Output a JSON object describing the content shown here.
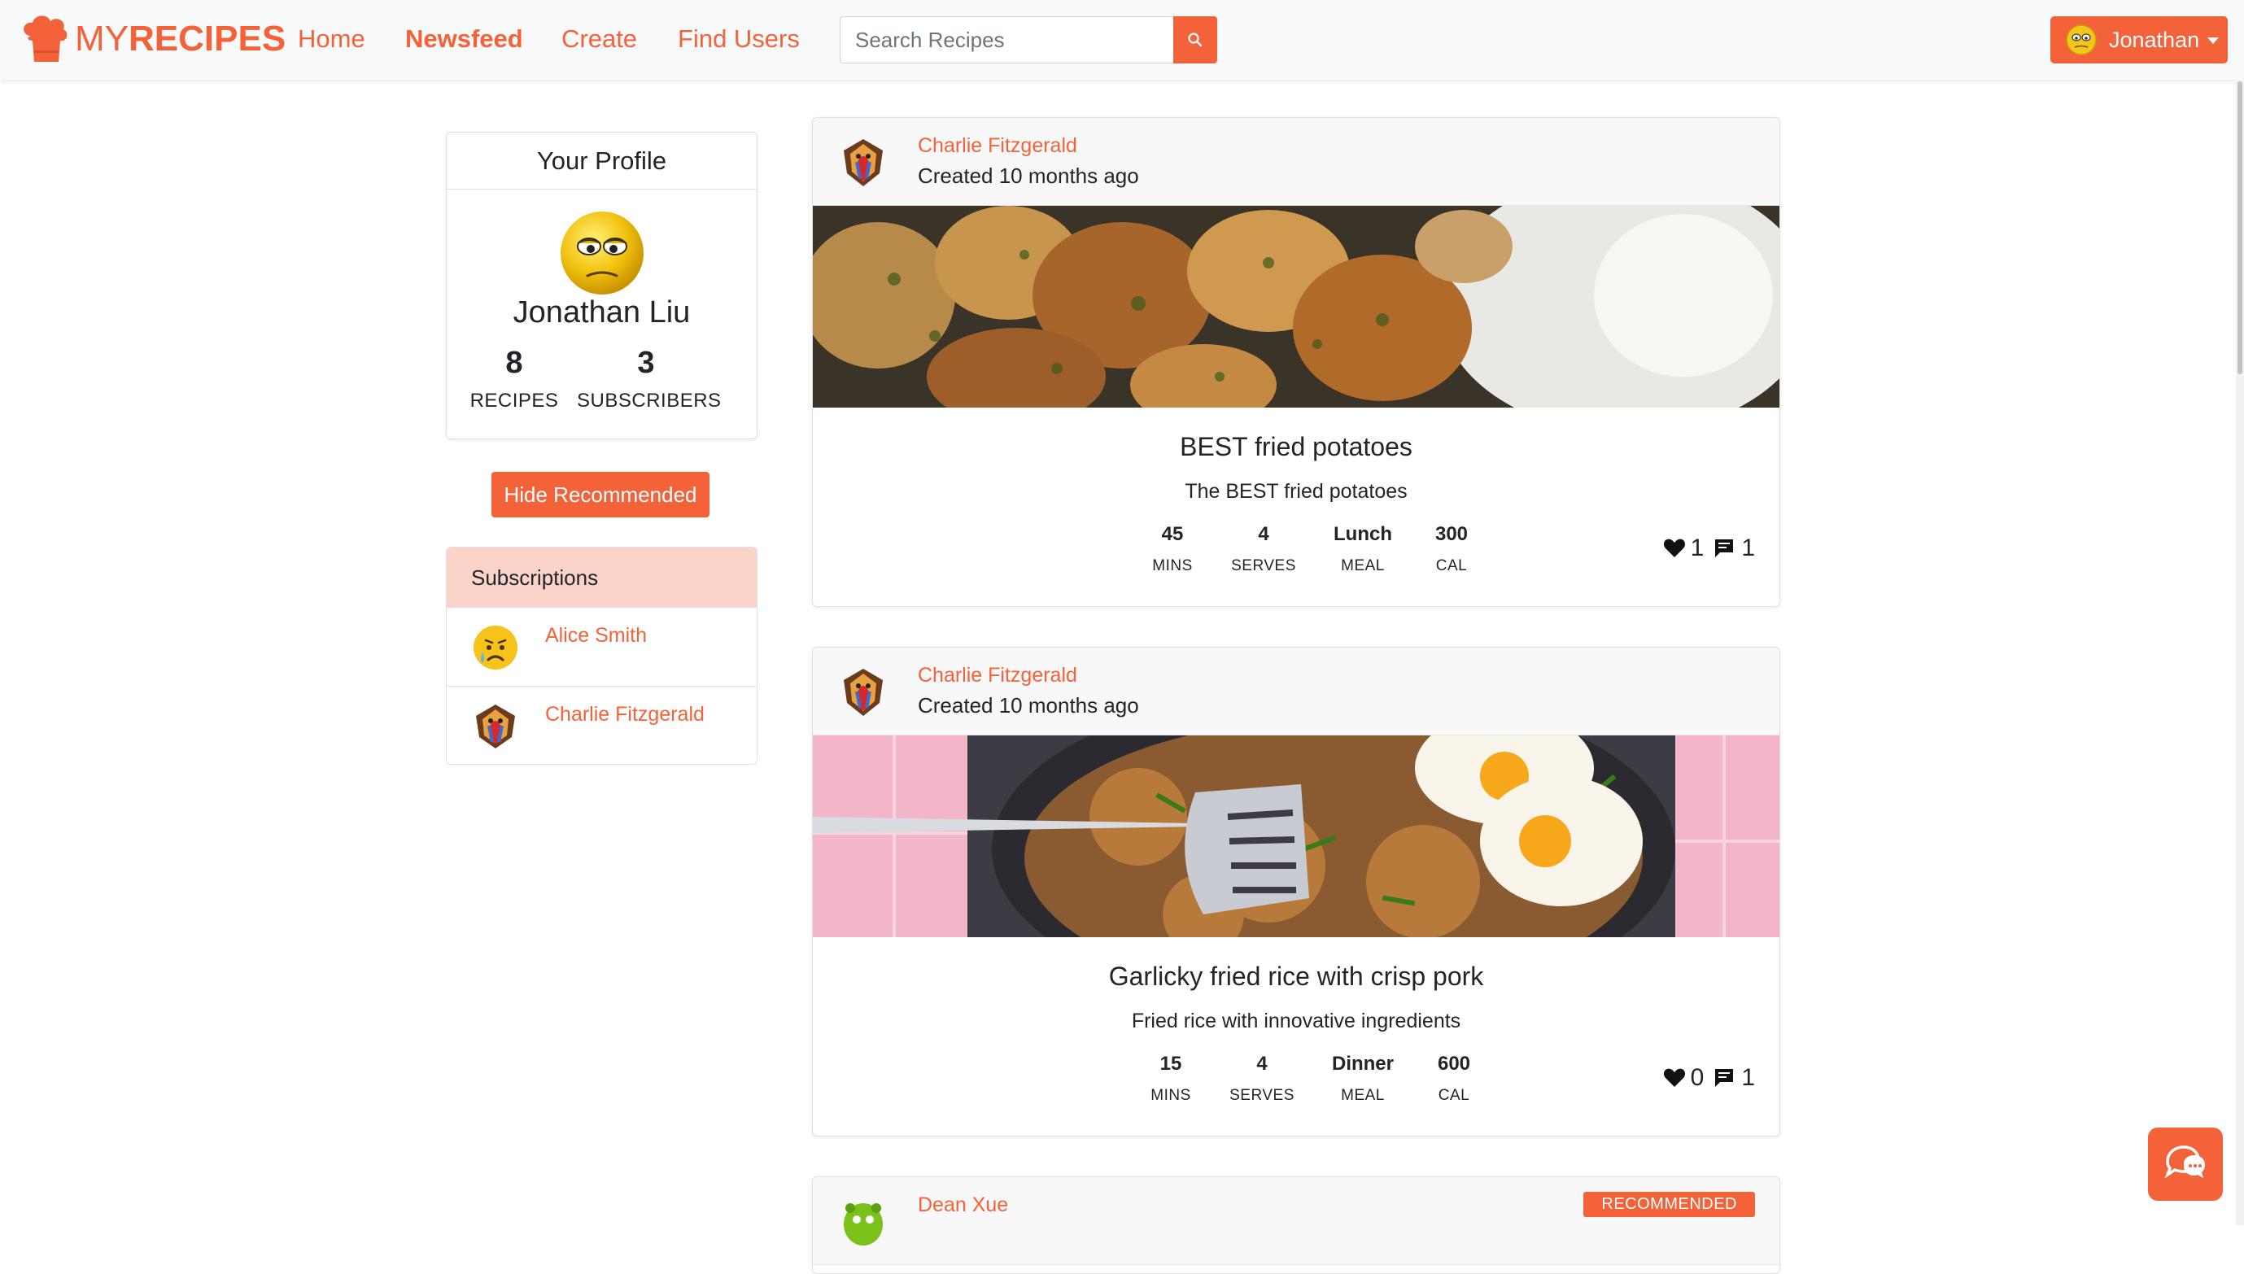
{
  "brand": {
    "prefix": "MY",
    "suffix": "RECIPES"
  },
  "nav": {
    "home": "Home",
    "newsfeed": "Newsfeed",
    "create": "Create",
    "find_users": "Find Users"
  },
  "search": {
    "placeholder": "Search Recipes"
  },
  "user_menu": {
    "label": "Jonathan"
  },
  "profile": {
    "header": "Your Profile",
    "name": "Jonathan Liu",
    "recipes_count": "8",
    "recipes_label": "RECIPES",
    "subscribers_count": "3",
    "subscribers_label": "SUBSCRIBERS"
  },
  "hide_recommended_label": "Hide Recommended",
  "subscriptions": {
    "header": "Subscriptions",
    "items": [
      {
        "name": "Alice Smith",
        "avatar_icon": "crying-face-icon"
      },
      {
        "name": "Charlie Fitzgerald",
        "avatar_icon": "mandrill-icon"
      }
    ]
  },
  "posts": [
    {
      "author": "Charlie Fitzgerald",
      "created": "Created 10 months ago",
      "title": "BEST fried potatoes",
      "description": "The BEST fried potatoes",
      "stats": [
        {
          "value": "45",
          "label": "MINS"
        },
        {
          "value": "4",
          "label": "SERVES"
        },
        {
          "value": "Lunch",
          "label": "MEAL"
        },
        {
          "value": "300",
          "label": "CAL"
        }
      ],
      "likes": "1",
      "comments": "1"
    },
    {
      "author": "Charlie Fitzgerald",
      "created": "Created 10 months ago",
      "title": "Garlicky fried rice with crisp pork",
      "description": "Fried rice with innovative ingredients",
      "stats": [
        {
          "value": "15",
          "label": "MINS"
        },
        {
          "value": "4",
          "label": "SERVES"
        },
        {
          "value": "Dinner",
          "label": "MEAL"
        },
        {
          "value": "600",
          "label": "CAL"
        }
      ],
      "likes": "0",
      "comments": "1"
    },
    {
      "author": "Dean Xue",
      "badge": "RECOMMENDED"
    }
  ],
  "colors": {
    "accent": "#f4623a",
    "subscriptions_header": "#fbd3c9",
    "navbar": "#f8f9fa"
  }
}
